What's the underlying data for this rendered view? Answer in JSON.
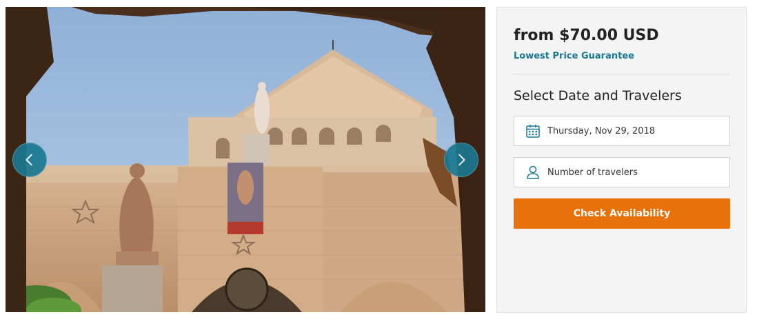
{
  "gallery": {
    "photo_description_icon": "church-courtyard-photo",
    "prev_icon": "chevron-left-icon",
    "next_icon": "chevron-right-icon"
  },
  "booking": {
    "price": "from $70.00 USD",
    "guarantee": "Lowest Price Guarantee",
    "section_title": "Select Date and Travelers",
    "date_value": "Thursday, Nov 29, 2018",
    "date_icon": "calendar-icon",
    "travelers_placeholder": "Number of travelers",
    "travelers_icon": "person-icon",
    "check_button": "Check Availability"
  },
  "colors": {
    "accent": "#1a7891",
    "button": "#e8710a",
    "panel_bg": "#f4f4f4"
  }
}
